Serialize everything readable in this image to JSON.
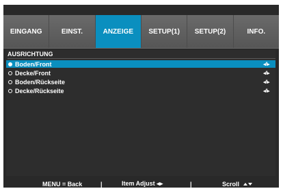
{
  "tabs": [
    {
      "label": "EINGANG",
      "active": false
    },
    {
      "label": "EINST.",
      "active": false
    },
    {
      "label": "ANZEIGE",
      "active": true
    },
    {
      "label": "SETUP(1)",
      "active": false
    },
    {
      "label": "SETUP(2)",
      "active": false
    },
    {
      "label": "INFO.",
      "active": false
    }
  ],
  "section": {
    "title": "AUSRICHTUNG"
  },
  "options": [
    {
      "label": "Boden/Front",
      "selected": true,
      "adjust": "◂//▸"
    },
    {
      "label": "Decke/Front",
      "selected": false,
      "adjust": "◂//▸"
    },
    {
      "label": "Boden/Rückseite",
      "selected": false,
      "adjust": "◂//▸"
    },
    {
      "label": "Decke/Rückseite",
      "selected": false,
      "adjust": "◂//▸"
    }
  ],
  "footer": {
    "back": "MENU = Back",
    "separator": "|",
    "item_adjust": "Item Adjust ◂▸",
    "scroll": "Scroll"
  },
  "colors": {
    "accent": "#0a8fbf",
    "tab_background": "#5c5c5c",
    "panel_background": "#2d2d2d"
  }
}
